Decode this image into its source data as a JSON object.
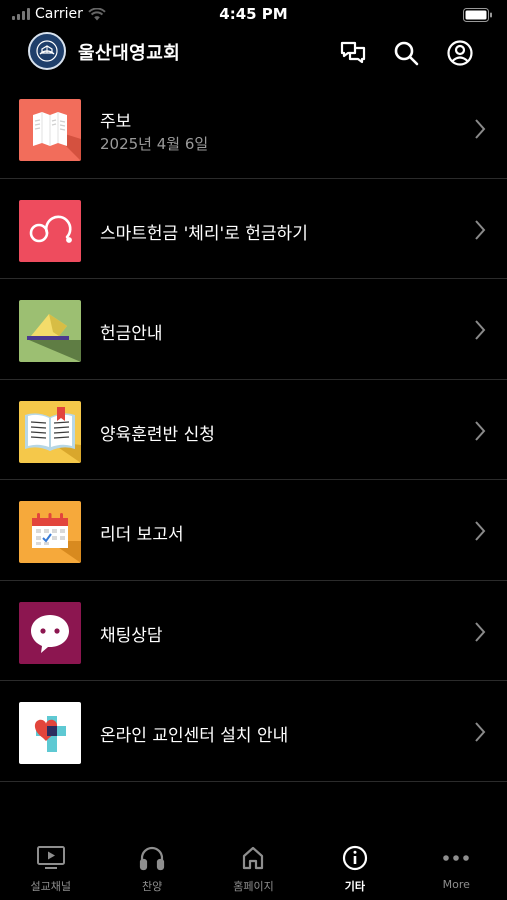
{
  "status_bar": {
    "carrier": "Carrier",
    "time": "4:45 PM"
  },
  "header": {
    "church_name": "울산대영교회",
    "icons": [
      "chat-icon",
      "search-icon",
      "profile-icon"
    ]
  },
  "list_items": [
    {
      "title": "주보",
      "subtitle": "2025년 4월 6일",
      "icon": "bulletin-icon",
      "color": "#f26d5b"
    },
    {
      "title": "스마트헌금 '체리'로 헌금하기",
      "icon": "cherry-icon",
      "color": "#ee4c5e"
    },
    {
      "title": "헌금안내",
      "icon": "offering-icon",
      "color": "#9cbf72"
    },
    {
      "title": "양육훈련반 신청",
      "icon": "book-icon",
      "color": "#f5c84a"
    },
    {
      "title": "리더 보고서",
      "icon": "calendar-icon",
      "color": "#f6a93b"
    },
    {
      "title": "채팅상담",
      "icon": "chat-bubble-icon",
      "color": "#8c1650"
    },
    {
      "title": "온라인 교인센터 설치 안내",
      "icon": "cross-heart-icon",
      "color": "#ffffff"
    }
  ],
  "tabs": [
    {
      "label": "설교채널",
      "icon": "tv-play-icon",
      "active": false
    },
    {
      "label": "찬양",
      "icon": "headphones-icon",
      "active": false
    },
    {
      "label": "홈페이지",
      "icon": "home-icon",
      "active": false
    },
    {
      "label": "기타",
      "icon": "info-icon",
      "active": true
    },
    {
      "label": "More",
      "icon": "more-dots-icon",
      "active": false
    }
  ]
}
